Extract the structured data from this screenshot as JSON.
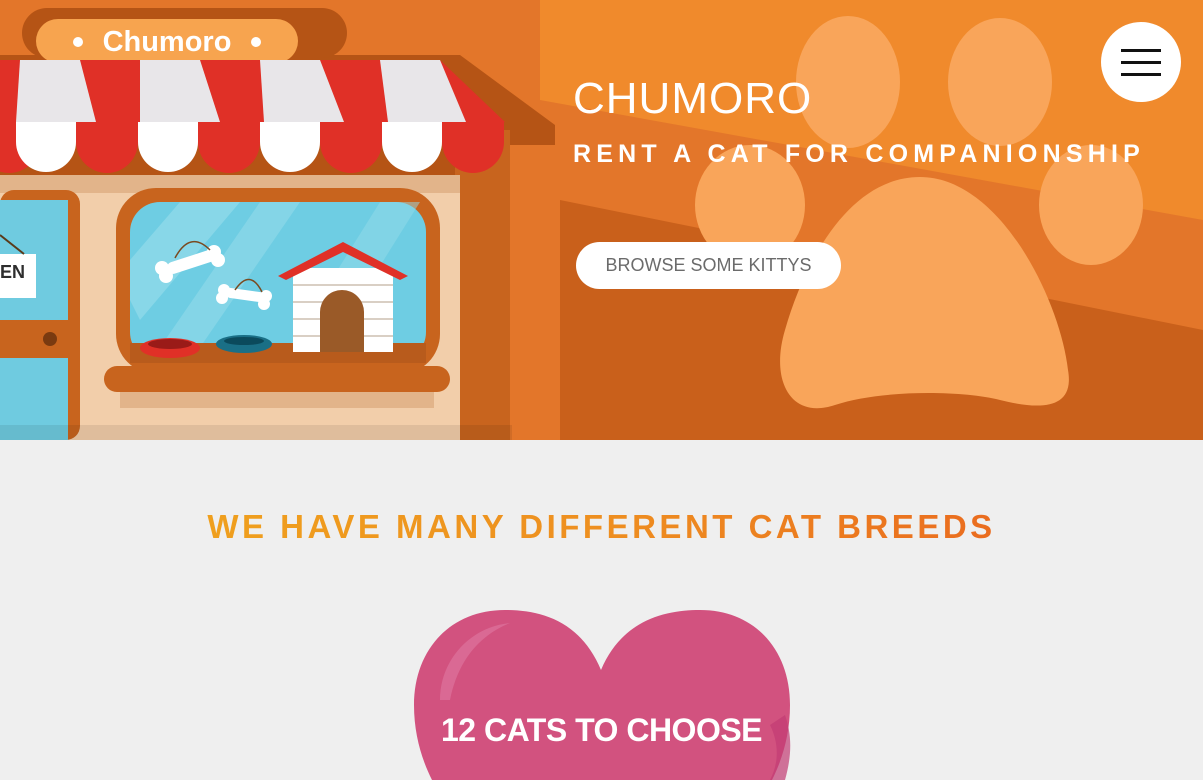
{
  "hero": {
    "shop_sign": "Chumoro",
    "open_sign": "EN",
    "title": "CHUMORO",
    "subtitle": "RENT A CAT FOR COMPANIONSHIP",
    "browse_button": "BROWSE SOME KITTYS"
  },
  "menu": {
    "icon": "hamburger-menu-icon"
  },
  "section": {
    "title": "WE HAVE MANY DIFFERENT CAT BREEDS"
  },
  "feature": {
    "heart_text": "12 CATS TO CHOOSE"
  },
  "colors": {
    "hero_orange": "#e87a22",
    "paw": "#f9a55a",
    "heart": "#d2527f",
    "title_start": "#f0a81c",
    "title_end": "#e85a1e"
  }
}
